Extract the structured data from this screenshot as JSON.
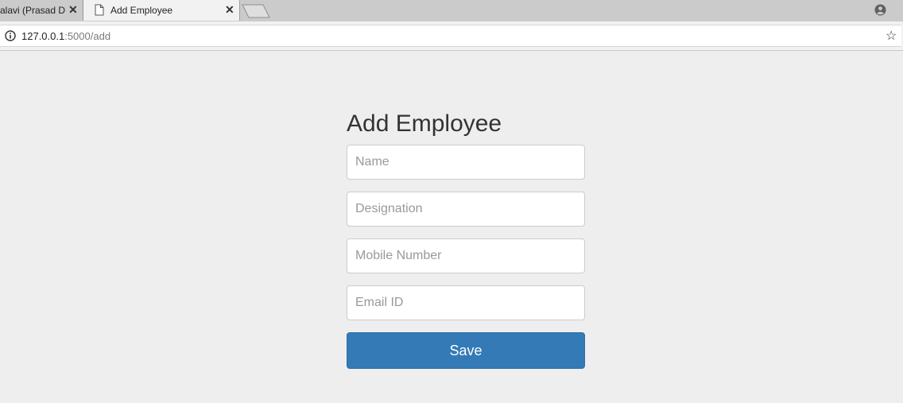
{
  "browser": {
    "tabs": [
      {
        "label": "alavi (Prasad D",
        "close": "✕"
      },
      {
        "label": "Add Employee",
        "close": "✕"
      }
    ],
    "address": {
      "host": "127.0.0.1",
      "path": ":5000/add"
    },
    "star_icon": "star-icon",
    "info_icon": "info-icon",
    "profile_icon": "account-icon"
  },
  "page": {
    "title": "Add Employee",
    "fields": [
      {
        "placeholder": "Name",
        "value": ""
      },
      {
        "placeholder": "Designation",
        "value": ""
      },
      {
        "placeholder": "Mobile Number",
        "value": ""
      },
      {
        "placeholder": "Email ID",
        "value": ""
      }
    ],
    "save_label": "Save",
    "button_color": "#337ab7"
  }
}
